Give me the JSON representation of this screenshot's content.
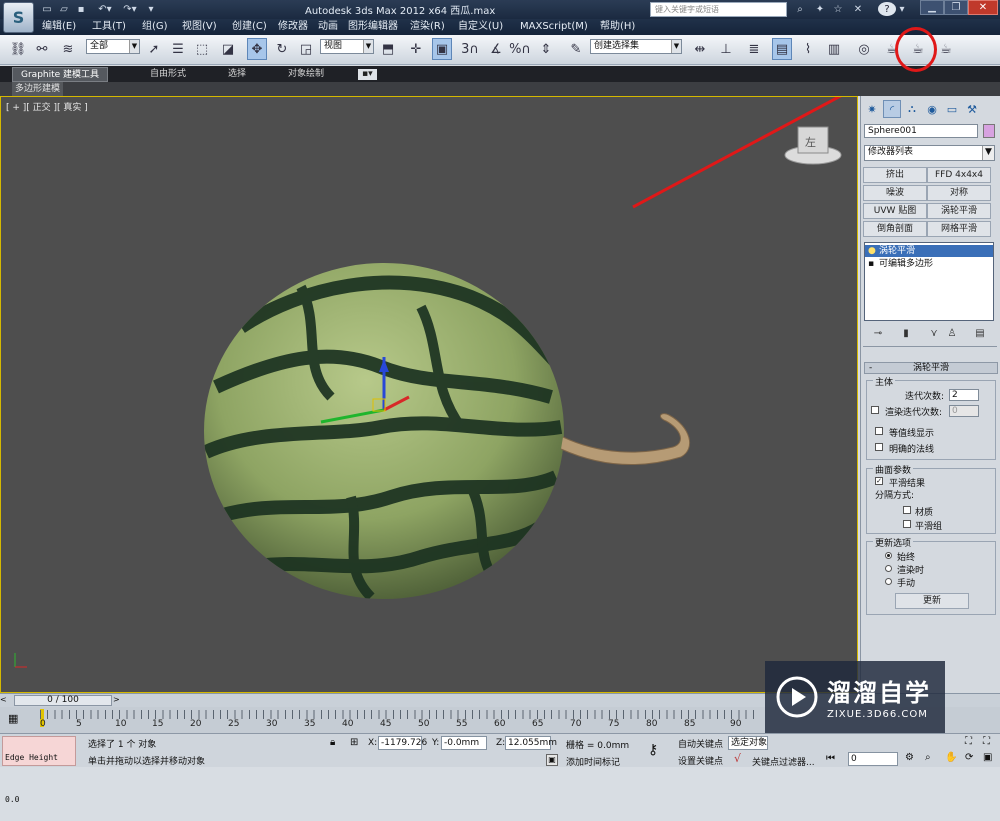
{
  "titlebar": {
    "title": "Autodesk 3ds Max  2012 x64    西瓜.max",
    "search_placeholder": "键入关键字或短语",
    "help_symbol": "?"
  },
  "menu": [
    "编辑(E)",
    "工具(T)",
    "组(G)",
    "视图(V)",
    "创建(C)",
    "修改器",
    "动画",
    "图形编辑器",
    "渲染(R)",
    "自定义(U)",
    "MAXScript(M)",
    "帮助(H)"
  ],
  "toolbar": {
    "selection_filter": "全部",
    "reference_coord": "视图",
    "named_selection": "创建选择集",
    "snap_label": "3",
    "angle_label": "%"
  },
  "ribbon": {
    "tabs": [
      "Graphite 建模工具",
      "自由形式",
      "选择",
      "对象绘制"
    ],
    "subtab": "多边形建模"
  },
  "viewport": {
    "label": "[ + ][ 正交 ][ 真实 ]",
    "viewcube_face": "左"
  },
  "command_panel": {
    "object_name": "Sphere001",
    "object_color": "#d7a2e0",
    "modifier_list": "修改器列表",
    "modifier_buttons": [
      "挤出",
      "FFD 4x4x4",
      "噪波",
      "对称",
      "UVW 贴图",
      "涡轮平滑",
      "倒角剖面",
      "网格平滑"
    ],
    "stack": [
      "涡轮平滑",
      "可编辑多边形"
    ],
    "rollout_title": "涡轮平滑",
    "main_group": "主体",
    "iterations_label": "迭代次数:",
    "iterations_value": "2",
    "render_iters_label": "渲染迭代次数:",
    "render_iters_value": "0",
    "isoline_label": "等值线显示",
    "explicit_normals_label": "明确的法线",
    "surface_group": "曲面参数",
    "smooth_result_label": "平滑结果",
    "separate_label": "分隔方式:",
    "materials_label": "材质",
    "smoothing_groups_label": "平滑组",
    "update_group": "更新选项",
    "always_label": "始终",
    "when_rendering_label": "渲染时",
    "manually_label": "手动",
    "update_button": "更新"
  },
  "timeline": {
    "frame_counter": "0 / 100",
    "ticks": [
      "0",
      "5",
      "10",
      "15",
      "20",
      "25",
      "30",
      "35",
      "40",
      "45",
      "50",
      "55",
      "60",
      "65",
      "70",
      "75",
      "80",
      "85",
      "90"
    ]
  },
  "status": {
    "maxscript_label": "Edge Height 0.0",
    "selection_text": "选择了 1 个 对象",
    "prompt_text": "单击并拖动以选择并移动对象",
    "x_value": "-1179.726",
    "y_value": "-0.0mm",
    "z_value": "12.055mm",
    "grid_text": "栅格 = 0.0mm",
    "add_time_tag": "添加时间标记",
    "auto_key": "自动关键点",
    "set_key": "设置关键点",
    "selected_label": "选定对象",
    "key_filters": "关键点过滤器...",
    "frame_field": "0"
  },
  "watermark": {
    "title": "溜溜自学",
    "url": "ZIXUE.3D66.COM"
  }
}
